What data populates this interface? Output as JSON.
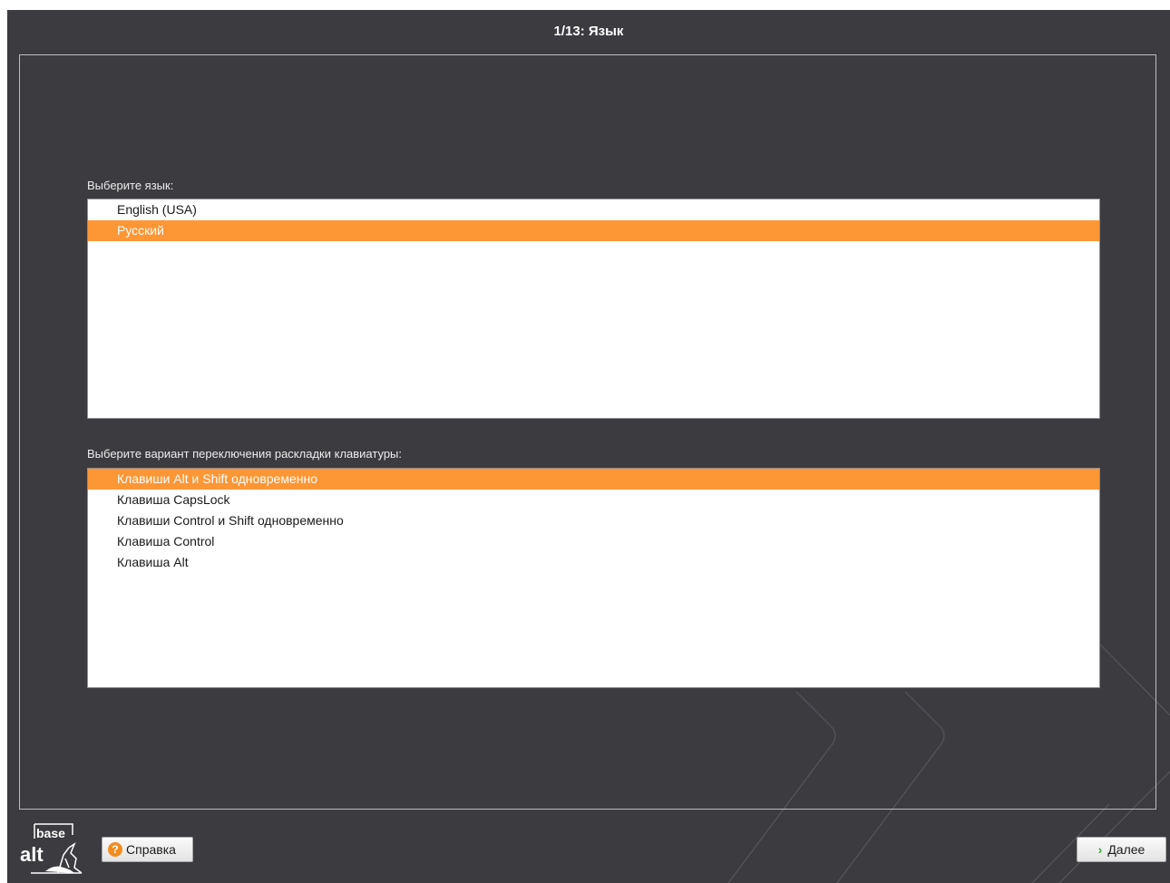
{
  "window": {
    "title": "1/13: Язык"
  },
  "language": {
    "label": "Выберите язык:",
    "options": [
      {
        "label": "English (USA)",
        "selected": false
      },
      {
        "label": "Русский",
        "selected": true
      }
    ]
  },
  "keyboard": {
    "label": "Выберите вариант переключения раскладки клавиатуры:",
    "options": [
      {
        "label": "Клавиши Alt и Shift одновременно",
        "selected": true
      },
      {
        "label": "Клавиша CapsLock",
        "selected": false
      },
      {
        "label": "Клавиши Control и Shift одновременно",
        "selected": false
      },
      {
        "label": "Клавиша Control",
        "selected": false
      },
      {
        "label": "Клавиша Alt",
        "selected": false
      }
    ]
  },
  "footer": {
    "logo_top": "base",
    "logo_bottom": "alt",
    "help_label": "Справка",
    "help_icon": "question-icon",
    "next_label": "Далее",
    "next_icon": "chevron-right-icon"
  },
  "colors": {
    "background": "#3c3b40",
    "selection": "#fd9635"
  }
}
